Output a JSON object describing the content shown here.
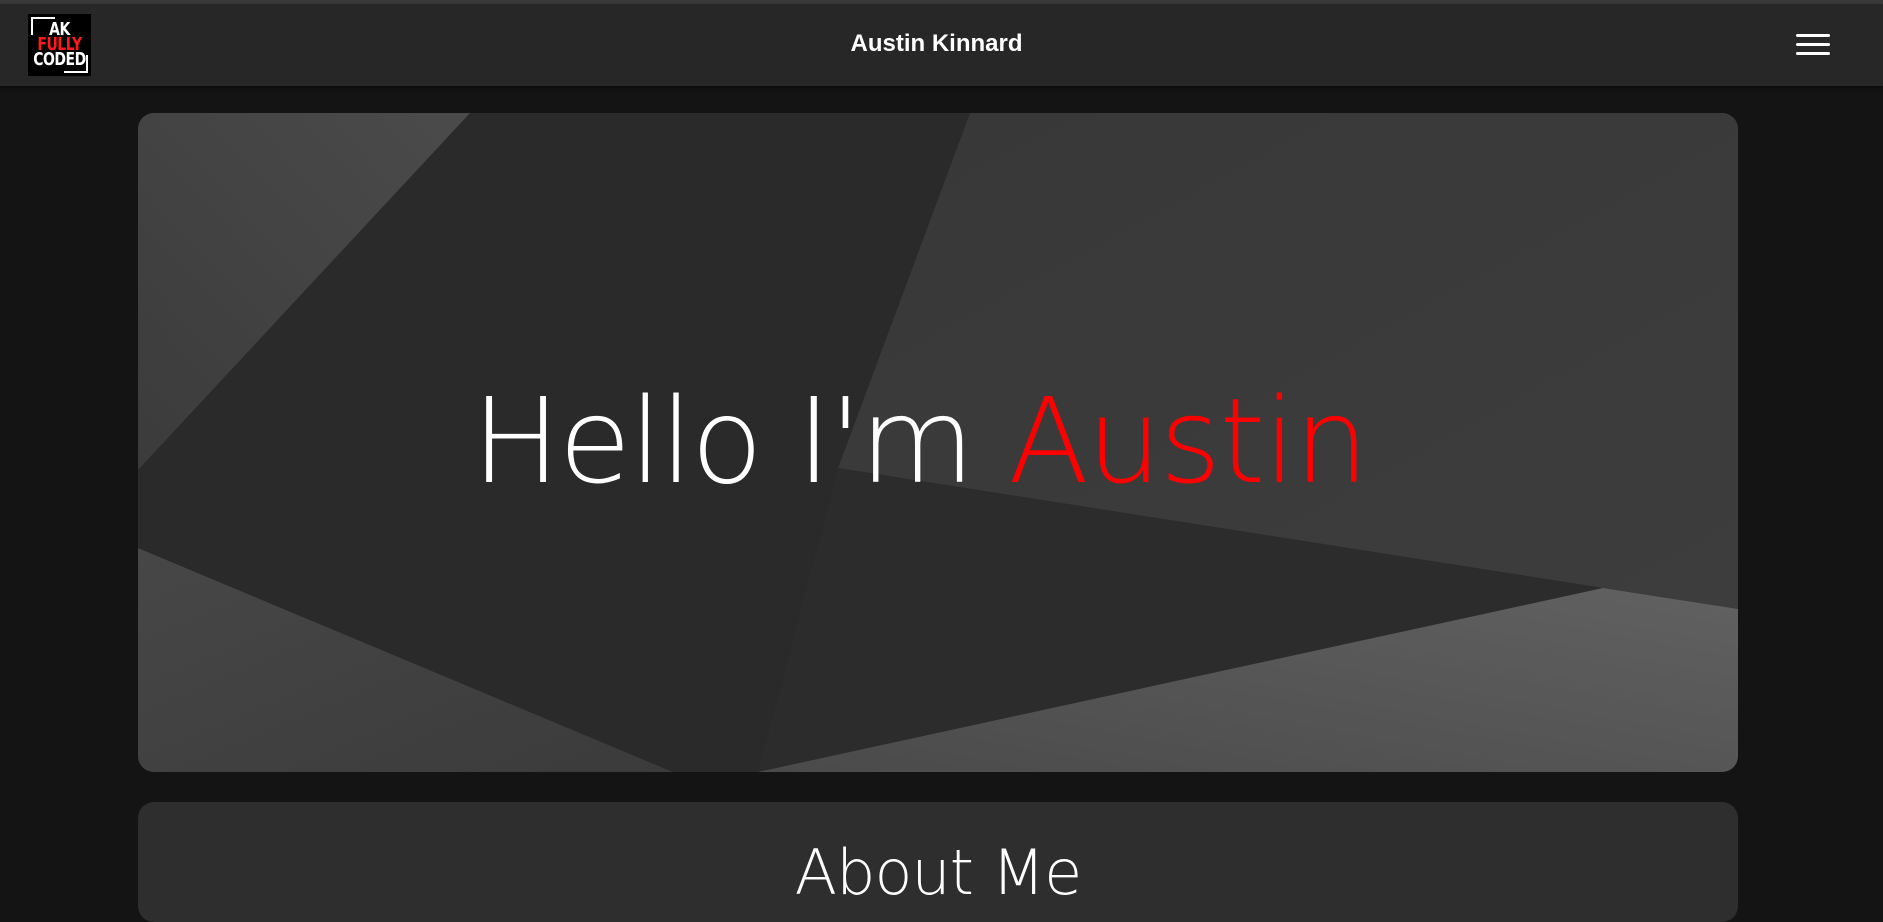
{
  "header": {
    "logo": {
      "line1": "AK",
      "line2": "FULLY",
      "line3": "CODED"
    },
    "site_title": "Austin Kinnard",
    "menu_icon": "hamburger-menu-icon"
  },
  "hero": {
    "greeting": "Hello I'm",
    "name": "Austin",
    "accent_color": "#ff0000"
  },
  "about": {
    "title": "About Me"
  },
  "colors": {
    "page_background": "#141414",
    "navbar_background": "#272727",
    "accent": "#ff0000",
    "text": "#ffffff"
  }
}
